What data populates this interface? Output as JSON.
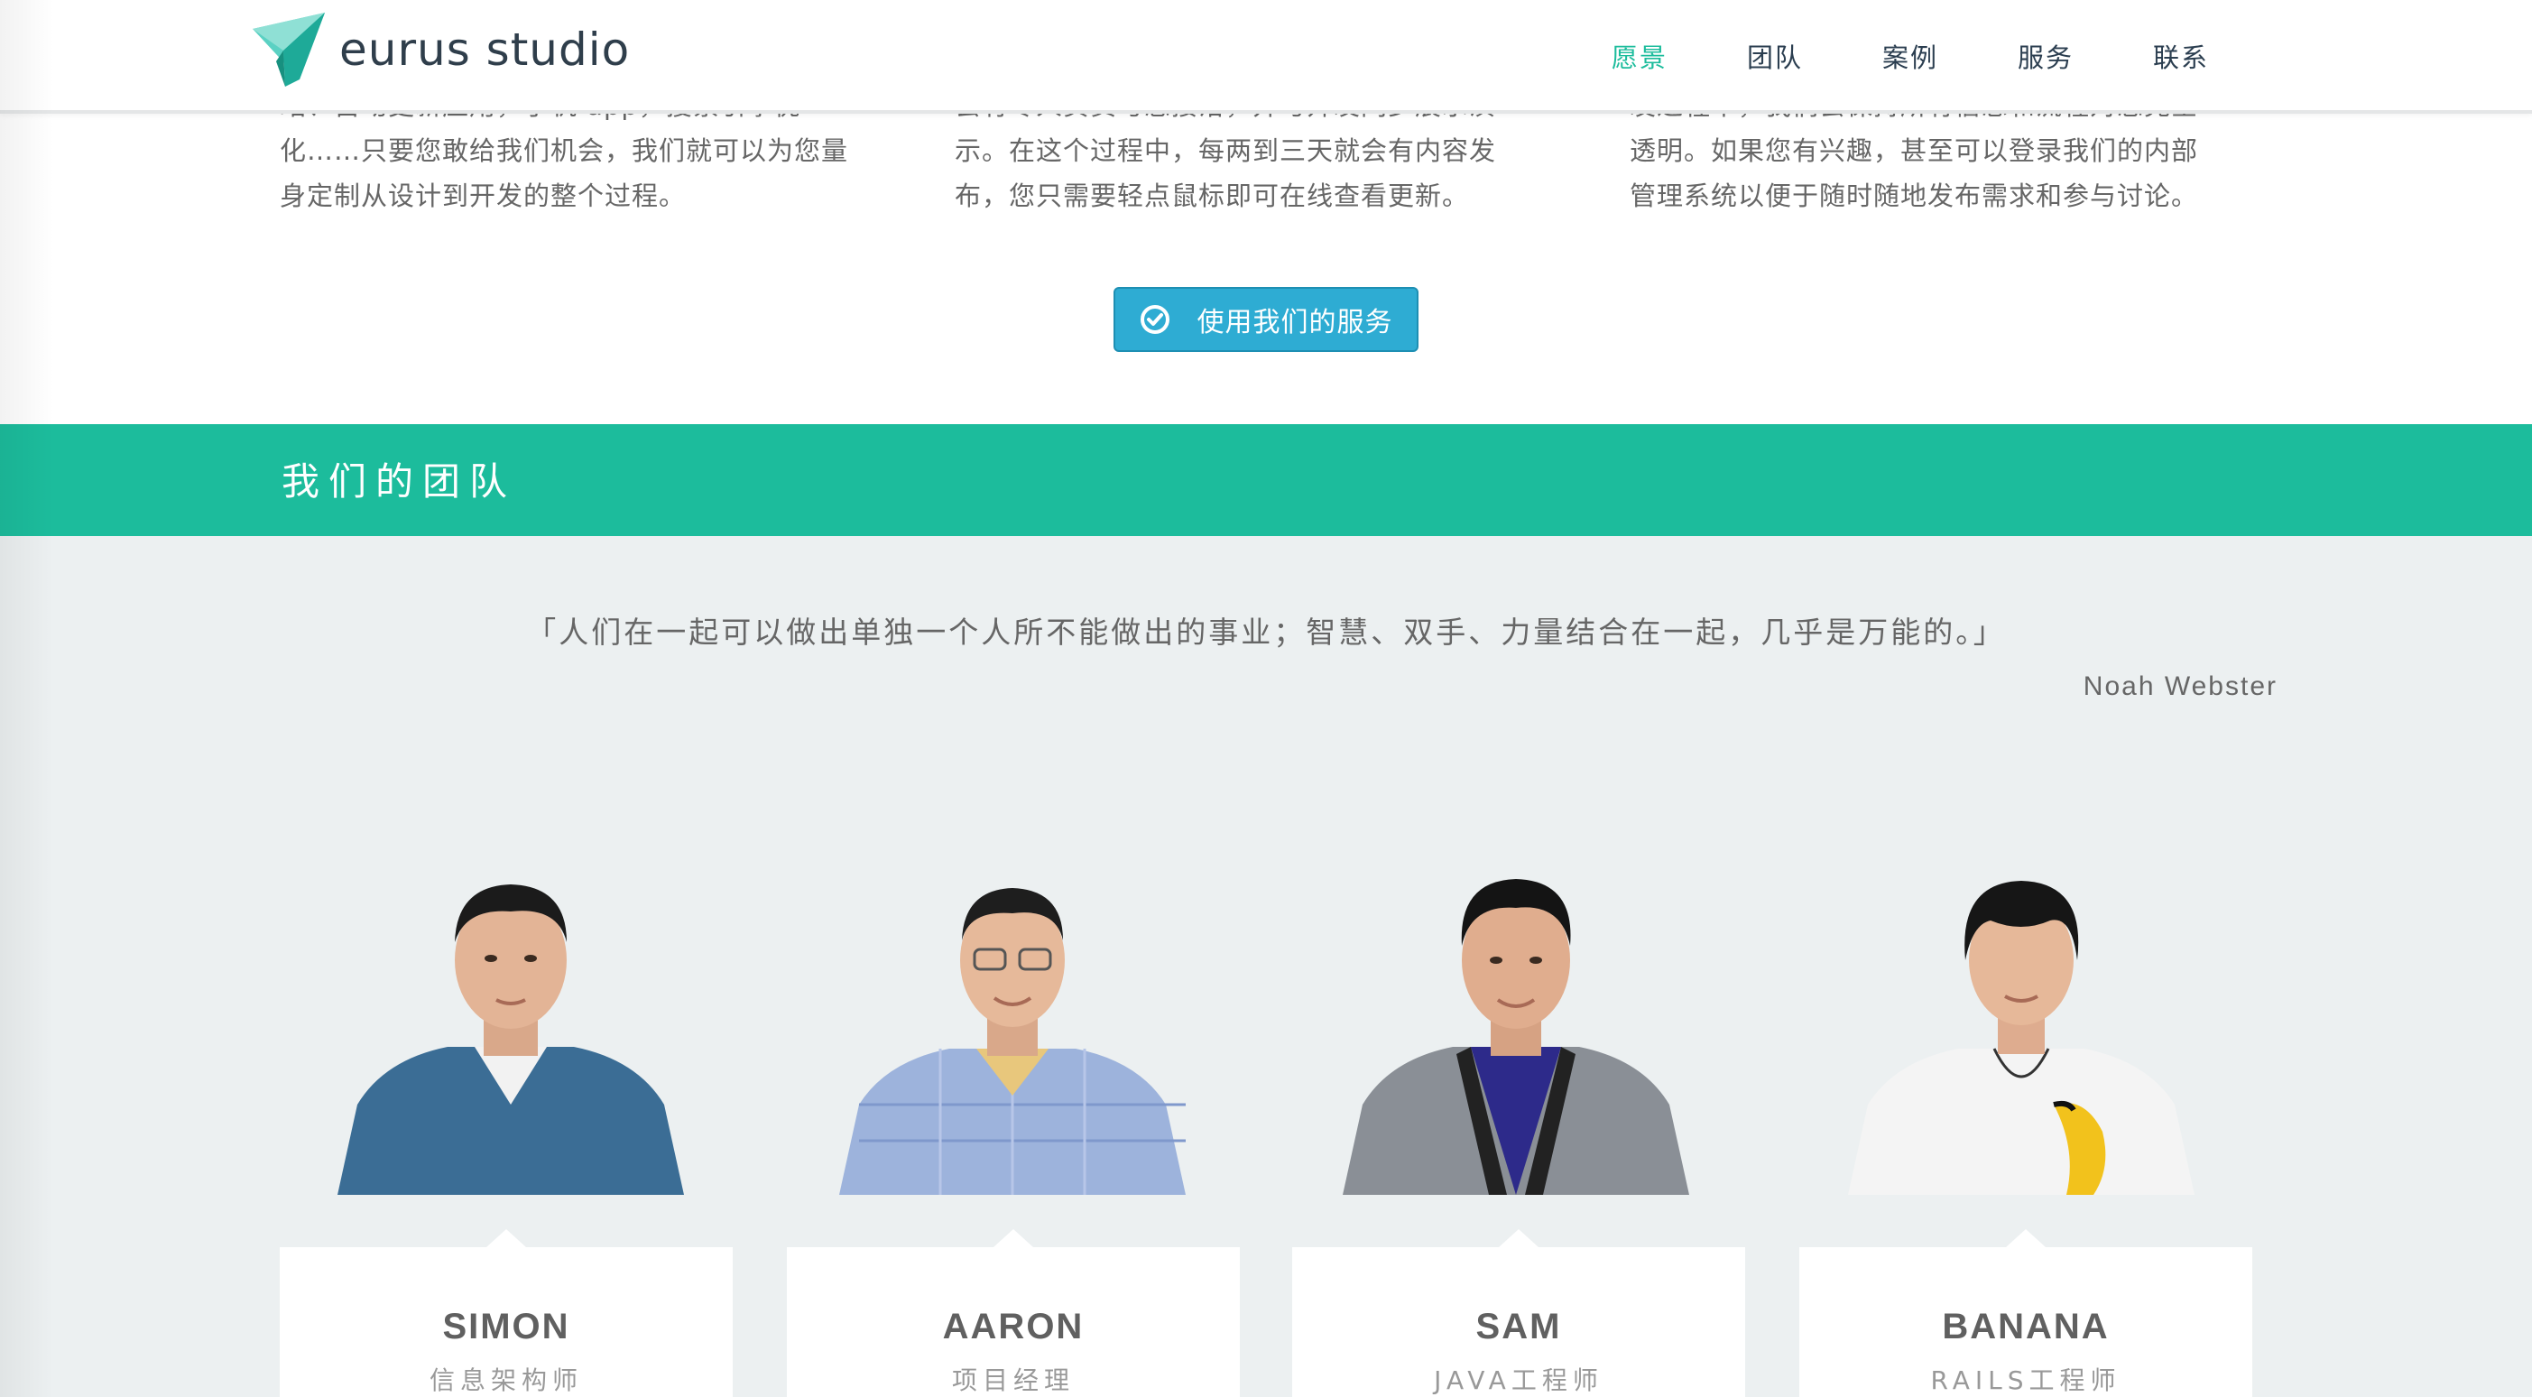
{
  "brand": {
    "name": "eurus studio",
    "accent": "#1cbc9c"
  },
  "nav": {
    "items": [
      {
        "label": "愿景",
        "active": true
      },
      {
        "label": "团队",
        "active": false
      },
      {
        "label": "案例",
        "active": false
      },
      {
        "label": "服务",
        "active": false
      },
      {
        "label": "联系",
        "active": false
      }
    ]
  },
  "services": {
    "columns": [
      {
        "lines": [
          "站、自动更新应用，手机 app，搜索引擎优",
          "化……只要您敢给我们机会，我们就可以为您量",
          "身定制从设计到开发的整个过程。"
        ]
      },
      {
        "lines": [
          "会有专人负责与您接洽，并与开发同步展示演",
          "示。在这个过程中，每两到三天就会有内容发",
          "布，您只需要轻点鼠标即可在线查看更新。"
        ]
      },
      {
        "lines": [
          "发过程中，我们会保持所有信息和流程对您完全",
          "透明。如果您有兴趣，甚至可以登录我们的内部",
          "管理系统以便于随时随地发布需求和参与讨论。"
        ]
      }
    ],
    "cta_label": "使用我们的服务",
    "cta_icon": "check-circle-icon",
    "cta_color": "#2eacd3"
  },
  "team": {
    "title": "我们的团队",
    "quote": "「人们在一起可以做出单独一个人所不能做出的事业；智慧、双手、力量结合在一起，几乎是万能的。」",
    "quote_author": "Noah Webster",
    "members": [
      {
        "name": "SIMON",
        "role": "信息架构师",
        "shirt": "#3b6d95"
      },
      {
        "name": "AARON",
        "role": "项目经理",
        "shirt": "#9db3dc"
      },
      {
        "name": "SAM",
        "role": "JAVA工程师",
        "shirt": "#8a8f96"
      },
      {
        "name": "BANANA",
        "role": "RAILS工程师",
        "shirt": "#f4f4f4"
      }
    ]
  }
}
